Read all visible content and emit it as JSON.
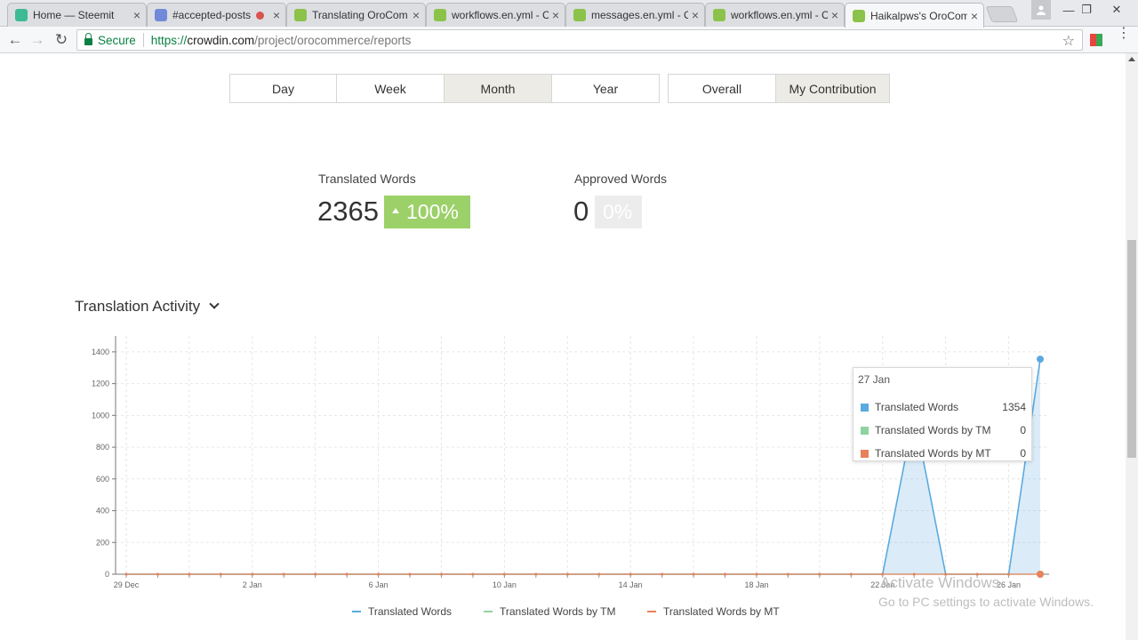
{
  "browser": {
    "tabs": [
      {
        "title": "Home — Steemit",
        "color": "#3cba92",
        "active": false
      },
      {
        "title": "#accepted-posts",
        "color": "#7289da",
        "active": false,
        "recording": true
      },
      {
        "title": "Translating OroCom",
        "color": "#8bc34a",
        "active": false
      },
      {
        "title": "workflows.en.yml - C",
        "color": "#8bc34a",
        "active": false
      },
      {
        "title": "messages.en.yml - C",
        "color": "#8bc34a",
        "active": false
      },
      {
        "title": "workflows.en.yml - C",
        "color": "#8bc34a",
        "active": false
      },
      {
        "title": "Haikalpws's OroCom",
        "color": "#8bc34a",
        "active": true
      }
    ],
    "tab_close_glyph": "×",
    "window": {
      "minimize": "—",
      "restore": "❐",
      "close": "✕"
    },
    "nav": {
      "back": "←",
      "forward": "→",
      "reload": "↻"
    },
    "address": {
      "secure_label": "Secure",
      "scheme": "https://",
      "host": "crowdin.com",
      "path": "/project/orocommerce/reports"
    },
    "star_glyph": "☆",
    "menu_glyph": "⋮"
  },
  "period_toggle": [
    "Day",
    "Week",
    "Month",
    "Year"
  ],
  "period_selected": "Month",
  "scope_toggle": [
    "Overall",
    "My Contribution"
  ],
  "scope_selected": "My Contribution",
  "stats": {
    "translated": {
      "label": "Translated Words",
      "value": "2365",
      "change": "100%"
    },
    "approved": {
      "label": "Approved Words",
      "value": "0",
      "change": "0%"
    }
  },
  "section": {
    "title": "Translation Activity"
  },
  "chart_data": {
    "type": "area",
    "title": "",
    "xlabel": "",
    "ylabel": "",
    "ylim": [
      0,
      1500
    ],
    "yticks": [
      0,
      200,
      400,
      600,
      800,
      1000,
      1200,
      1400
    ],
    "x": [
      "29 Dec",
      "30 Dec",
      "31 Dec",
      "1 Jan",
      "2 Jan",
      "3 Jan",
      "4 Jan",
      "5 Jan",
      "6 Jan",
      "7 Jan",
      "8 Jan",
      "9 Jan",
      "10 Jan",
      "11 Jan",
      "12 Jan",
      "13 Jan",
      "14 Jan",
      "15 Jan",
      "16 Jan",
      "17 Jan",
      "18 Jan",
      "19 Jan",
      "20 Jan",
      "21 Jan",
      "22 Jan",
      "23 Jan",
      "24 Jan",
      "25 Jan",
      "26 Jan",
      "27 Jan"
    ],
    "xticks": [
      "29 Dec",
      "2 Jan",
      "6 Jan",
      "10 Jan",
      "14 Jan",
      "18 Jan",
      "22 Jan",
      "26 Jan"
    ],
    "grid": true,
    "legend_position": "bottom",
    "series": [
      {
        "name": "Translated Words",
        "color": "#5aaadf",
        "values": [
          0,
          0,
          0,
          0,
          0,
          0,
          0,
          0,
          0,
          0,
          0,
          0,
          0,
          0,
          0,
          0,
          0,
          0,
          0,
          0,
          0,
          0,
          0,
          0,
          0,
          1011,
          0,
          0,
          0,
          1354
        ]
      },
      {
        "name": "Translated Words by TM",
        "color": "#8fd3a0",
        "values": [
          0,
          0,
          0,
          0,
          0,
          0,
          0,
          0,
          0,
          0,
          0,
          0,
          0,
          0,
          0,
          0,
          0,
          0,
          0,
          0,
          0,
          0,
          0,
          0,
          0,
          0,
          0,
          0,
          0,
          0
        ]
      },
      {
        "name": "Translated Words by MT",
        "color": "#e8825a",
        "values": [
          0,
          0,
          0,
          0,
          0,
          0,
          0,
          0,
          0,
          0,
          0,
          0,
          0,
          0,
          0,
          0,
          0,
          0,
          0,
          0,
          0,
          0,
          0,
          0,
          0,
          0,
          0,
          0,
          0,
          0
        ]
      }
    ],
    "tooltip": {
      "date": "27 Jan",
      "rows": [
        {
          "name": "Translated Words",
          "value": "1354",
          "color": "#5aaadf"
        },
        {
          "name": "Translated Words by TM",
          "value": "0",
          "color": "#8fd3a0"
        },
        {
          "name": "Translated Words by MT",
          "value": "0",
          "color": "#e8825a"
        }
      ]
    }
  },
  "watermark": {
    "line1": "Activate Windows",
    "line2": "Go to PC settings to activate Windows."
  }
}
